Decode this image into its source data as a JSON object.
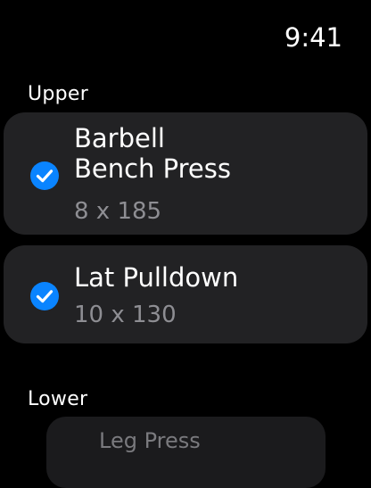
{
  "status": {
    "time": "9:41"
  },
  "colors": {
    "background": "#000000",
    "row_background": "#222224",
    "accent": "#0a84ff",
    "secondary_text": "#8e8e93"
  },
  "sections": [
    {
      "title": "Upper",
      "items": [
        {
          "title_line1": "Barbell",
          "title_line2": "Bench Press",
          "detail": "8 x 185",
          "checked": true,
          "icon": "checkmark-circle-icon"
        },
        {
          "title_line1": "Lat Pulldown",
          "detail": "10 x 130",
          "checked": true,
          "icon": "checkmark-circle-icon"
        }
      ]
    },
    {
      "title": "Lower",
      "items": [
        {
          "title_line1": "Leg Press"
        }
      ]
    }
  ]
}
